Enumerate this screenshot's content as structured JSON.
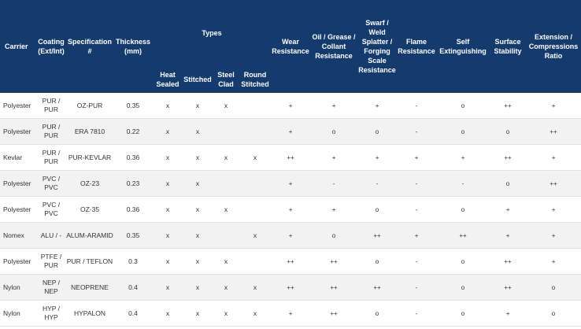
{
  "headers": {
    "carrier": "Carrier",
    "coating": "Coating (Ext/Int)",
    "specification": "Specification #",
    "thickness": "Thickness (mm)",
    "types": "Types",
    "wear": "Wear Resistance",
    "oil": "Oil / Grease / Collant Resistance",
    "swarf": "Swarf / Weld Splatter / Forging Scale Resistance",
    "flame": "Flame Resistance",
    "self_ext": "Self Extinguishing",
    "surface": "Surface Stability",
    "extension": "Extension / Compressions Ratio"
  },
  "type_headers": {
    "heat_sealed": "Heat Sealed",
    "stitched": "Stitched",
    "steel_clad": "Steel Clad",
    "round_stitched": "Round Stitched"
  },
  "rows": [
    {
      "carrier": "Polyester",
      "coating": "PUR / PUR",
      "spec": "OZ-PUR",
      "thickness": "0.35",
      "heat_sealed": "x",
      "stitched": "x",
      "steel_clad": "x",
      "round_stitched": "",
      "wear": "+",
      "oil": "+",
      "swarf": "+",
      "flame": "-",
      "self_ext": "o",
      "surface": "++",
      "extension": "+"
    },
    {
      "carrier": "Polyester",
      "coating": "PUR / PUR",
      "spec": "ERA 7810",
      "thickness": "0.22",
      "heat_sealed": "x",
      "stitched": "x",
      "steel_clad": "",
      "round_stitched": "",
      "wear": "+",
      "oil": "o",
      "swarf": "o",
      "flame": "-",
      "self_ext": "o",
      "surface": "o",
      "extension": "++"
    },
    {
      "carrier": "Kevlar",
      "coating": "PUR / PUR",
      "spec": "PUR-KEVLAR",
      "thickness": "0.36",
      "heat_sealed": "x",
      "stitched": "x",
      "steel_clad": "x",
      "round_stitched": "x",
      "wear": "++",
      "oil": "+",
      "swarf": "+",
      "flame": "+",
      "self_ext": "+",
      "surface": "++",
      "extension": "+"
    },
    {
      "carrier": "Polyester",
      "coating": "PVC / PVC",
      "spec": "OZ-23",
      "thickness": "0.23",
      "heat_sealed": "x",
      "stitched": "x",
      "steel_clad": "",
      "round_stitched": "",
      "wear": "+",
      "oil": "-",
      "swarf": "-",
      "flame": "-",
      "self_ext": "-",
      "surface": "o",
      "extension": "++"
    },
    {
      "carrier": "Polyester",
      "coating": "PVC / PVC",
      "spec": "OZ-35",
      "thickness": "0.36",
      "heat_sealed": "x",
      "stitched": "x",
      "steel_clad": "x",
      "round_stitched": "",
      "wear": "+",
      "oil": "+",
      "swarf": "o",
      "flame": "-",
      "self_ext": "o",
      "surface": "+",
      "extension": "+"
    },
    {
      "carrier": "Nomex",
      "coating": "ALU / -",
      "spec": "ALUM-ARAMID",
      "thickness": "0.35",
      "heat_sealed": "x",
      "stitched": "x",
      "steel_clad": "",
      "round_stitched": "x",
      "wear": "+",
      "oil": "o",
      "swarf": "++",
      "flame": "+",
      "self_ext": "++",
      "surface": "+",
      "extension": "+"
    },
    {
      "carrier": "Polyester",
      "coating": "PTFE / PUR",
      "spec": "PUR / TEFLON",
      "thickness": "0.3",
      "heat_sealed": "x",
      "stitched": "x",
      "steel_clad": "x",
      "round_stitched": "",
      "wear": "++",
      "oil": "++",
      "swarf": "o",
      "flame": "-",
      "self_ext": "o",
      "surface": "++",
      "extension": "+"
    },
    {
      "carrier": "Nylon",
      "coating": "NEP / NEP",
      "spec": "NEOPRENE",
      "thickness": "0.4",
      "heat_sealed": "x",
      "stitched": "x",
      "steel_clad": "x",
      "round_stitched": "x",
      "wear": "++",
      "oil": "++",
      "swarf": "++",
      "flame": "-",
      "self_ext": "o",
      "surface": "++",
      "extension": "o"
    },
    {
      "carrier": "Nylon",
      "coating": "HYP / HYP",
      "spec": "HYPALON",
      "thickness": "0.4",
      "heat_sealed": "x",
      "stitched": "x",
      "steel_clad": "x",
      "round_stitched": "x",
      "wear": "+",
      "oil": "++",
      "swarf": "o",
      "flame": "-",
      "self_ext": "o",
      "surface": "+",
      "extension": "o"
    }
  ]
}
